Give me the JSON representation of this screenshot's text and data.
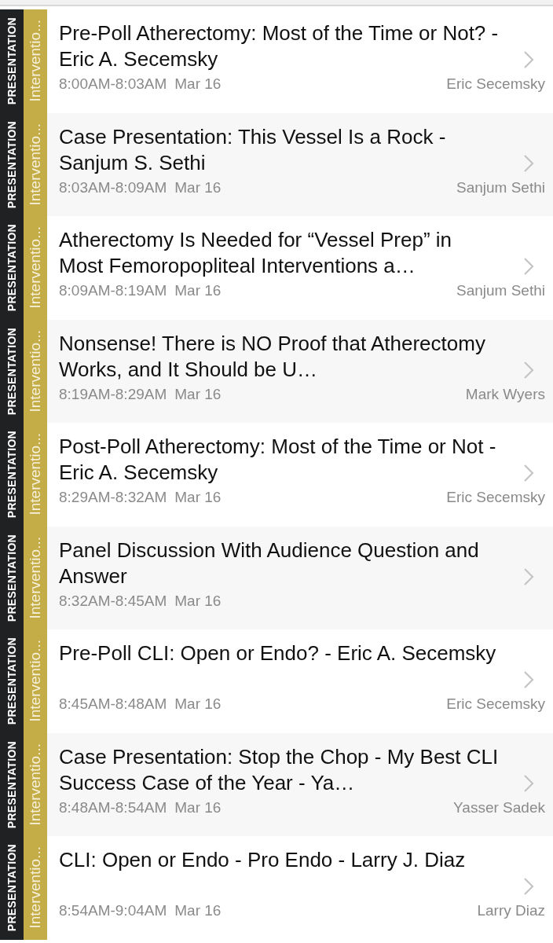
{
  "sessions": [
    {
      "type_label": "PRESENTATION",
      "track": "Interventio...",
      "title": "Pre-Poll Atherectomy: Most of the Time or Not? - Eric A. Secemsky",
      "time": "8:00AM-8:03AM",
      "date": "Mar 16",
      "speaker": "Eric Secemsky"
    },
    {
      "type_label": "PRESENTATION",
      "track": "Interventio...",
      "title": "Case Presentation: This Vessel Is a Rock - Sanjum S. Sethi",
      "time": "8:03AM-8:09AM",
      "date": "Mar 16",
      "speaker": "Sanjum Sethi"
    },
    {
      "type_label": "PRESENTATION",
      "track": "Interventio...",
      "title": "Atherectomy Is Needed for “Vessel Prep” in Most Femoropopliteal Interventions a…",
      "time": "8:09AM-8:19AM",
      "date": "Mar 16",
      "speaker": "Sanjum Sethi"
    },
    {
      "type_label": "PRESENTATION",
      "track": "Interventio...",
      "title": "Nonsense! There is NO Proof that Atherectomy Works, and It Should be U…",
      "time": "8:19AM-8:29AM",
      "date": "Mar 16",
      "speaker": "Mark Wyers"
    },
    {
      "type_label": "PRESENTATION",
      "track": "Interventio...",
      "title": "Post-Poll Atherectomy: Most of the Time or Not - Eric A. Secemsky",
      "time": "8:29AM-8:32AM",
      "date": "Mar 16",
      "speaker": "Eric Secemsky"
    },
    {
      "type_label": "PRESENTATION",
      "track": "Interventio...",
      "title": "Panel Discussion With Audience Question and Answer",
      "time": "8:32AM-8:45AM",
      "date": "Mar 16"
    },
    {
      "type_label": "PRESENTATION",
      "track": "Interventio...",
      "title": "Pre-Poll CLI: Open or Endo? - Eric A. Secemsky",
      "time": "8:45AM-8:48AM",
      "date": "Mar 16",
      "speaker": "Eric Secemsky"
    },
    {
      "type_label": "PRESENTATION",
      "track": "Interventio...",
      "title": "Case Presentation: Stop the Chop - My Best CLI Success Case of the Year - Ya…",
      "time": "8:48AM-8:54AM",
      "date": "Mar 16",
      "speaker": "Yasser Sadek"
    },
    {
      "type_label": "PRESENTATION",
      "track": "Interventio...",
      "title": "CLI: Open or Endo - Pro Endo - Larry J. Diaz",
      "time": "8:54AM-9:04AM",
      "date": "Mar 16",
      "speaker": "Larry Diaz"
    }
  ]
}
